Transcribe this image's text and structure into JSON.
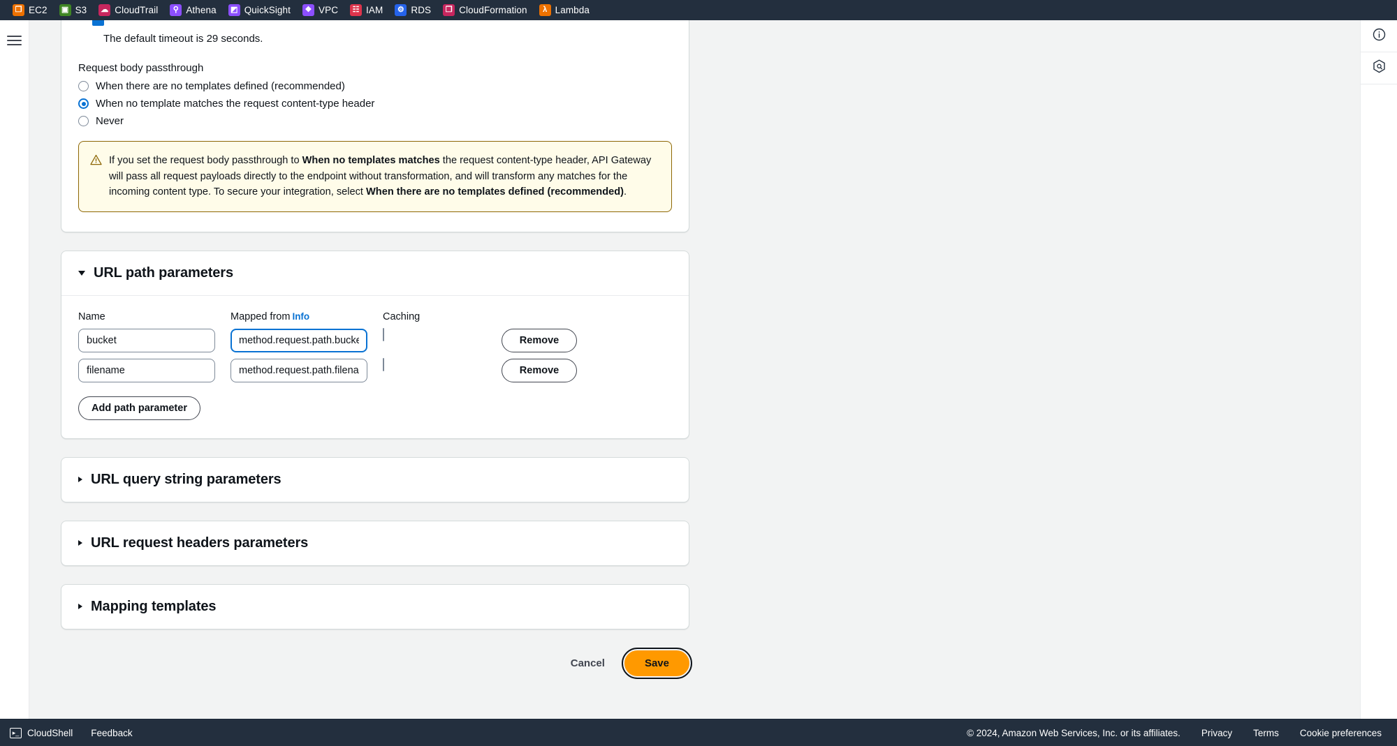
{
  "servicebar": {
    "items": [
      {
        "label": "EC2",
        "icon": "ec2-icon",
        "color": "#ed7100",
        "glyph": "❐"
      },
      {
        "label": "S3",
        "icon": "s3-icon",
        "color": "#3f8624",
        "glyph": "▣"
      },
      {
        "label": "CloudTrail",
        "icon": "cloudtrail-icon",
        "color": "#c7265e",
        "glyph": "☁"
      },
      {
        "label": "Athena",
        "icon": "athena-icon",
        "color": "#8c4fff",
        "glyph": "⚲"
      },
      {
        "label": "QuickSight",
        "icon": "quicksight-icon",
        "color": "#8c4fff",
        "glyph": "◩"
      },
      {
        "label": "VPC",
        "icon": "vpc-icon",
        "color": "#8c4fff",
        "glyph": "❖"
      },
      {
        "label": "IAM",
        "icon": "iam-icon",
        "color": "#dd344c",
        "glyph": "☷"
      },
      {
        "label": "RDS",
        "icon": "rds-icon",
        "color": "#2563eb",
        "glyph": "⚙"
      },
      {
        "label": "CloudFormation",
        "icon": "cloudformation-icon",
        "color": "#c7265e",
        "glyph": "❐"
      },
      {
        "label": "Lambda",
        "icon": "lambda-icon",
        "color": "#ed7100",
        "glyph": "λ"
      }
    ]
  },
  "main": {
    "timeout_note": "The default timeout is 29 seconds.",
    "passthrough": {
      "label": "Request body passthrough",
      "options": [
        {
          "label": "When there are no templates defined (recommended)",
          "selected": false
        },
        {
          "label": "When no template matches the request content-type header",
          "selected": true
        },
        {
          "label": "Never",
          "selected": false
        }
      ]
    },
    "alert": {
      "icon": "warning-triangle-icon",
      "part1": "If you set the request body passthrough to ",
      "bold1": "When no templates matches",
      "part2": " the request content-type header, API Gateway will pass all request payloads directly to the endpoint without transformation, and will transform any matches for the incoming content type. To secure your integration, select ",
      "bold2": "When there are no templates defined (recommended)",
      "part3": "."
    },
    "path_params": {
      "title": "URL path parameters",
      "expanded": true,
      "headers": {
        "name": "Name",
        "mapped_from": "Mapped from",
        "info_link": "Info",
        "caching": "Caching"
      },
      "rows": [
        {
          "name": "bucket",
          "mapped_from": "method.request.path.bucket",
          "caching": false,
          "remove_label": "Remove",
          "focused": true
        },
        {
          "name": "filename",
          "mapped_from": "method.request.path.filename",
          "caching": false,
          "remove_label": "Remove",
          "focused": false
        }
      ],
      "add_label": "Add path parameter"
    },
    "collapsed_panels": [
      {
        "title": "URL query string parameters"
      },
      {
        "title": "URL request headers parameters"
      },
      {
        "title": "Mapping templates"
      }
    ],
    "actions": {
      "cancel_label": "Cancel",
      "save_label": "Save"
    }
  },
  "rightrail": {
    "items": [
      {
        "icon": "info-circle-icon"
      },
      {
        "icon": "shield-hexagon-icon"
      }
    ]
  },
  "footer": {
    "cloudshell_label": "CloudShell",
    "cloudshell_icon": "terminal-icon",
    "feedback_label": "Feedback",
    "copyright": "© 2024, Amazon Web Services, Inc. or its affiliates.",
    "links": [
      "Privacy",
      "Terms",
      "Cookie preferences"
    ]
  },
  "colors": {
    "nav_bg": "#232f3e",
    "accent_blue": "#0972d3",
    "save_orange": "#ff9900",
    "alert_bg": "#fffce9",
    "alert_border": "#8d6605"
  }
}
